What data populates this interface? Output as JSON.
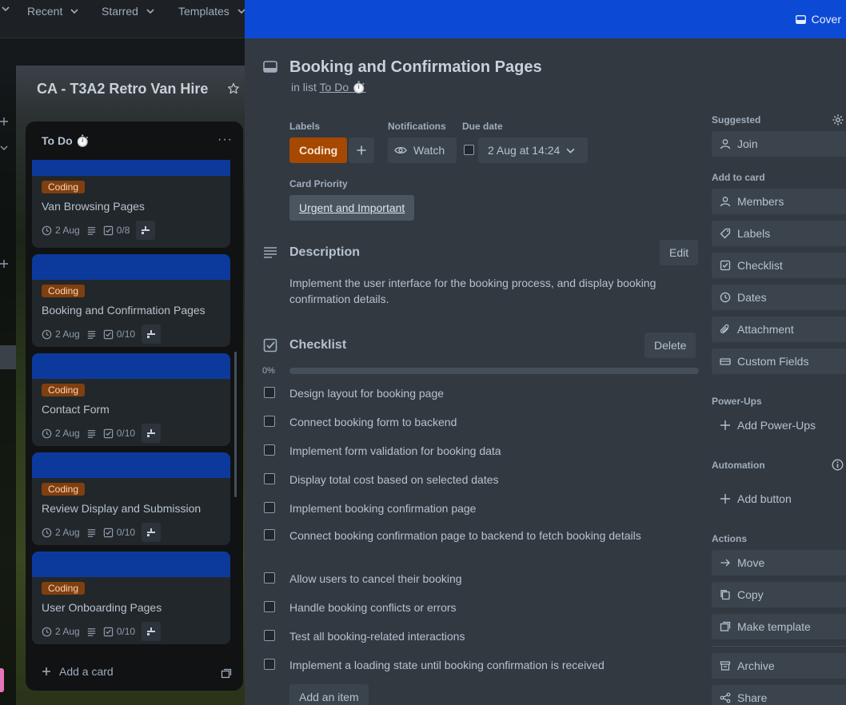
{
  "topnav": {
    "recent": "Recent",
    "starred": "Starred",
    "templates": "Templates"
  },
  "board": {
    "title": "CA - T3A2 Retro Van Hire",
    "list": {
      "title": "To Do ⏱️",
      "cards": [
        {
          "label": "Coding",
          "title": "Van Browsing Pages",
          "date": "2 Aug",
          "checklist": "0/8"
        },
        {
          "label": "Coding",
          "title": "Booking and Confirmation Pages",
          "date": "2 Aug",
          "checklist": "0/10"
        },
        {
          "label": "Coding",
          "title": "Contact Form",
          "date": "2 Aug",
          "checklist": "0/10"
        },
        {
          "label": "Coding",
          "title": "Review Display and Submission",
          "date": "2 Aug",
          "checklist": "0/10"
        },
        {
          "label": "Coding",
          "title": "User Onboarding Pages",
          "date": "2 Aug",
          "checklist": "0/10"
        }
      ],
      "add_card": "Add a card"
    }
  },
  "modal": {
    "cover_label": "Cover",
    "title": "Booking and Confirmation Pages",
    "in_list_prefix": "in list",
    "list_name": "To Do ⏱️",
    "labels_heading": "Labels",
    "label_chip": "Coding",
    "notifications_heading": "Notifications",
    "watch_label": "Watch",
    "due_heading": "Due date",
    "due_value": "2 Aug at 14:24",
    "priority_heading": "Card Priority",
    "priority_value": "Urgent and Important",
    "description_heading": "Description",
    "edit_label": "Edit",
    "description_text": "Implement the user interface for the booking process, and display booking confirmation details.",
    "checklist_heading": "Checklist",
    "delete_label": "Delete",
    "progress_label": "0%",
    "progress_value": 0,
    "checklist_items": [
      "Design layout for booking page",
      "Connect booking form to backend",
      "Implement form validation for booking data",
      "Display total cost based on selected dates",
      "Implement booking confirmation page",
      "Connect booking confirmation page to backend to fetch booking details",
      "Allow users to cancel their booking",
      "Handle booking conflicts or errors",
      "Test all booking-related interactions",
      "Implement a loading state until booking confirmation is received"
    ],
    "add_item_label": "Add an item"
  },
  "sidebar": {
    "suggested_heading": "Suggested",
    "join": "Join",
    "add_to_card_heading": "Add to card",
    "members": "Members",
    "labels": "Labels",
    "checklist": "Checklist",
    "dates": "Dates",
    "attachment": "Attachment",
    "custom_fields": "Custom Fields",
    "powerups_heading": "Power-Ups",
    "add_powerups": "Add Power-Ups",
    "automation_heading": "Automation",
    "add_button": "Add button",
    "actions_heading": "Actions",
    "move": "Move",
    "copy": "Copy",
    "make_template": "Make template",
    "archive": "Archive",
    "share": "Share"
  },
  "colors": {
    "cover": "#0c4ad6",
    "label_coding": "#a54800",
    "card_cover": "#0c3a9c",
    "modal_bg": "#323940"
  }
}
